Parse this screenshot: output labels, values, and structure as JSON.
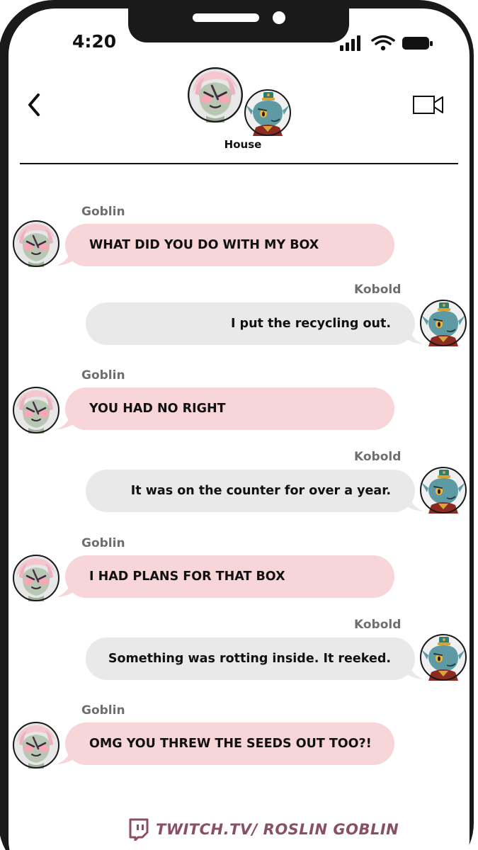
{
  "status_bar": {
    "time": "4:20"
  },
  "header": {
    "title": "House",
    "back_icon": "chevron-left-icon",
    "video_icon": "video-camera-icon"
  },
  "colors": {
    "goblin_bubble": "#f7d5d9",
    "kobold_bubble": "#e9e9e9",
    "sender_name": "#6e6e6e",
    "footer": "#8a4f66"
  },
  "messages": [
    {
      "sender": "Goblin",
      "text": "WHAT DID YOU DO WITH MY BOX"
    },
    {
      "sender": "Kobold",
      "text": "I put the recycling out."
    },
    {
      "sender": "Goblin",
      "text": "YOU HAD NO RIGHT"
    },
    {
      "sender": "Kobold",
      "text": "It was on the counter for over a year."
    },
    {
      "sender": "Goblin",
      "text": "I HAD PLANS FOR THAT BOX"
    },
    {
      "sender": "Kobold",
      "text": "Something was rotting inside. It reeked."
    },
    {
      "sender": "Goblin",
      "text": "OMG YOU THREW THE SEEDS OUT TOO?!"
    }
  ],
  "footer": {
    "text": "TWITCH.TV/ ROSLIN GOBLIN",
    "icon": "twitch-icon"
  }
}
